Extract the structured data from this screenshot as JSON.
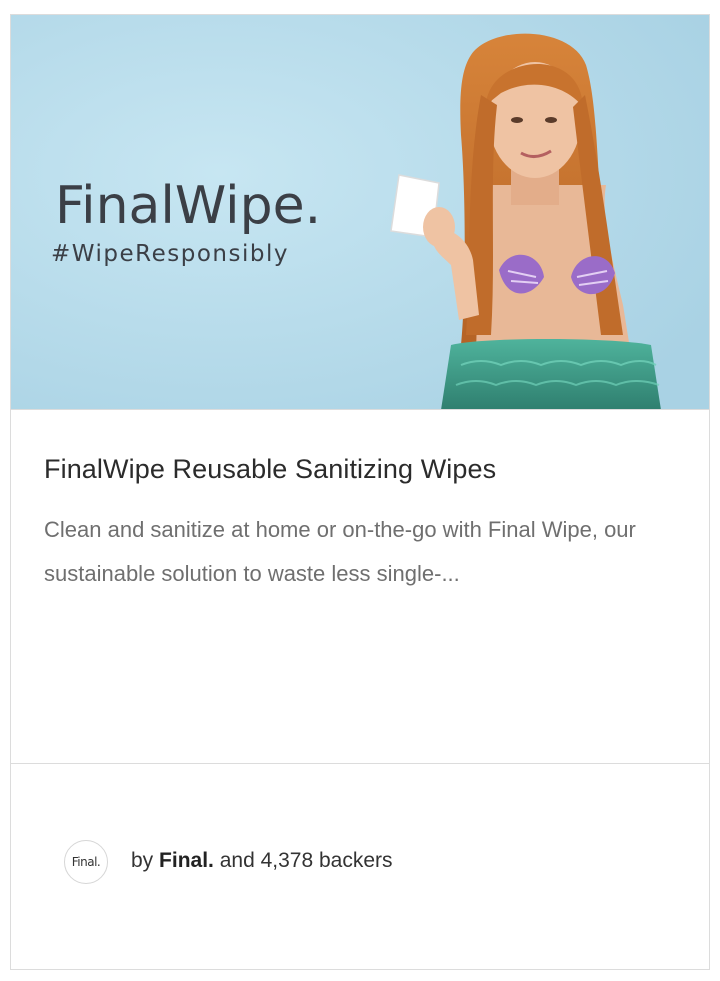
{
  "campaign": {
    "hero_image": {
      "logo_text": "FinalWipe.",
      "hashtag": "#WipeResponsibly"
    },
    "title": "FinalWipe Reusable Sanitizing Wipes",
    "description": "Clean and sanitize at home or on-the-go with Final Wipe, our sustainable solution to waste less single-...",
    "creator": {
      "avatar_text": "Final.",
      "by_label": "by",
      "name": "Final.",
      "backers_text": "and 4,378 backers"
    }
  },
  "colors": {
    "hero_background": "#b9dcea",
    "logo_text": "#3b3f46",
    "hair": "#c8732e",
    "tail": "#3f9a86",
    "shell": "#9a6cc8"
  }
}
